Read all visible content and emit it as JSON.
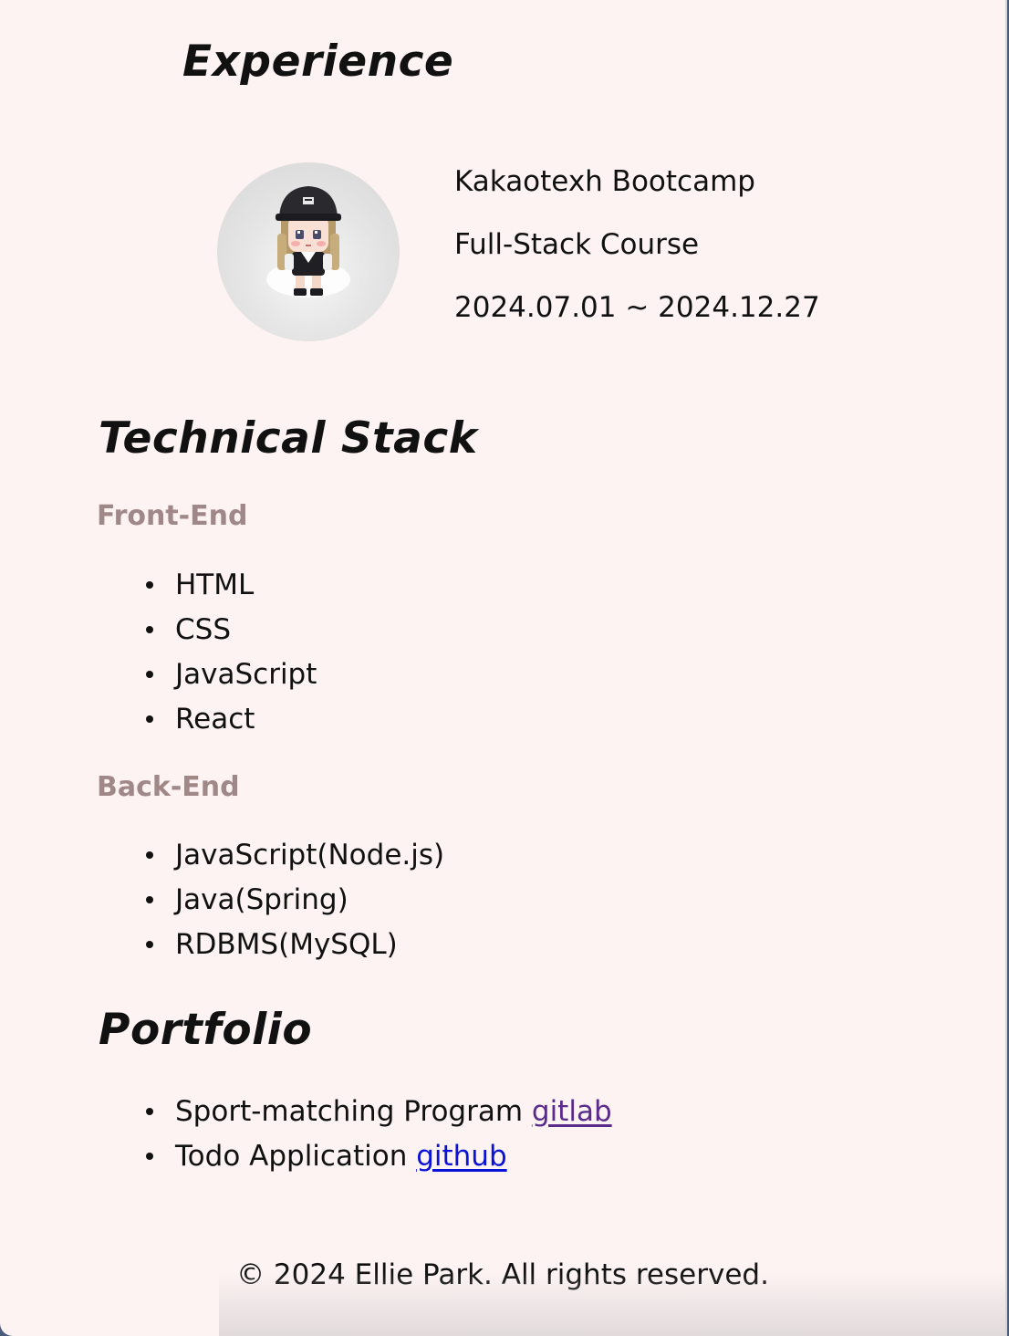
{
  "experience": {
    "title": "Experience",
    "avatar_icon": "pixel-character-icon",
    "lines": [
      "Kakaotexh Bootcamp",
      "Full-Stack Course",
      "2024.07.01 ~ 2024.12.27"
    ]
  },
  "tech_stack": {
    "title": "Technical Stack",
    "front_end": {
      "title": "Front-End",
      "items": [
        "HTML",
        "CSS",
        "JavaScript",
        "React"
      ]
    },
    "back_end": {
      "title": "Back-End",
      "items": [
        "JavaScript(Node.js)",
        "Java(Spring)",
        "RDBMS(MySQL)"
      ]
    }
  },
  "portfolio": {
    "title": "Portfolio",
    "items": [
      {
        "text": "Sport-matching Program ",
        "link": "gitlab"
      },
      {
        "text": "Todo Application ",
        "link": "github"
      }
    ]
  },
  "footer": {
    "text": "© 2024 Ellie Park. All rights reserved."
  },
  "colors": {
    "background": "#fcf3f2",
    "subheading": "#a08888",
    "visited_link": "#5a2a8c",
    "link": "#0a12d6"
  }
}
